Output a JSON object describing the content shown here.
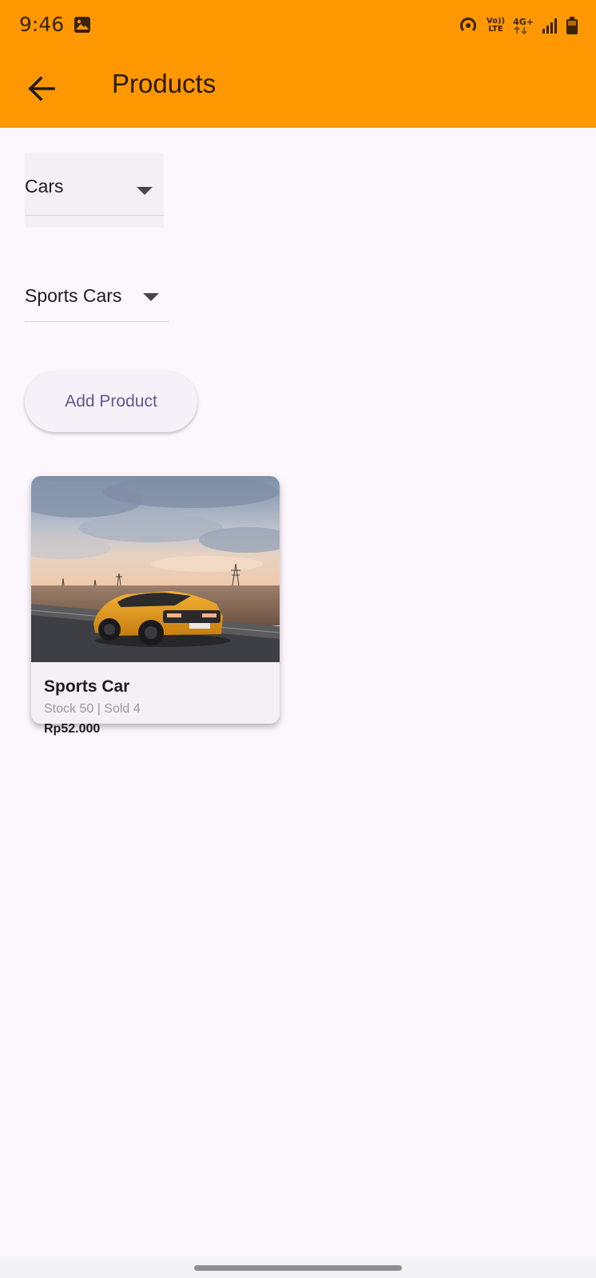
{
  "status_bar": {
    "time": "9:46",
    "volte_top": "Vo))",
    "volte_bottom": "LTE",
    "network": "4G+",
    "icons": [
      "gallery-icon",
      "hotspot-icon",
      "volte-icon",
      "network-4g-icon",
      "signal-icon",
      "battery-icon"
    ]
  },
  "app_bar": {
    "title": "Products",
    "back_icon": "arrow-left-icon",
    "background": "#FF9800"
  },
  "filters": {
    "category": "Cars",
    "subcategory": "Sports Cars"
  },
  "actions": {
    "add_product_label": "Add Product"
  },
  "products": [
    {
      "name": "Sports Car",
      "meta": "Stock 50 | Sold 4",
      "price": "Rp52.000",
      "image": "yellow sports car on desert road"
    }
  ],
  "colors": {
    "accent": "#FF9800",
    "button_text": "#65558F",
    "background": "#FCF7FC"
  }
}
